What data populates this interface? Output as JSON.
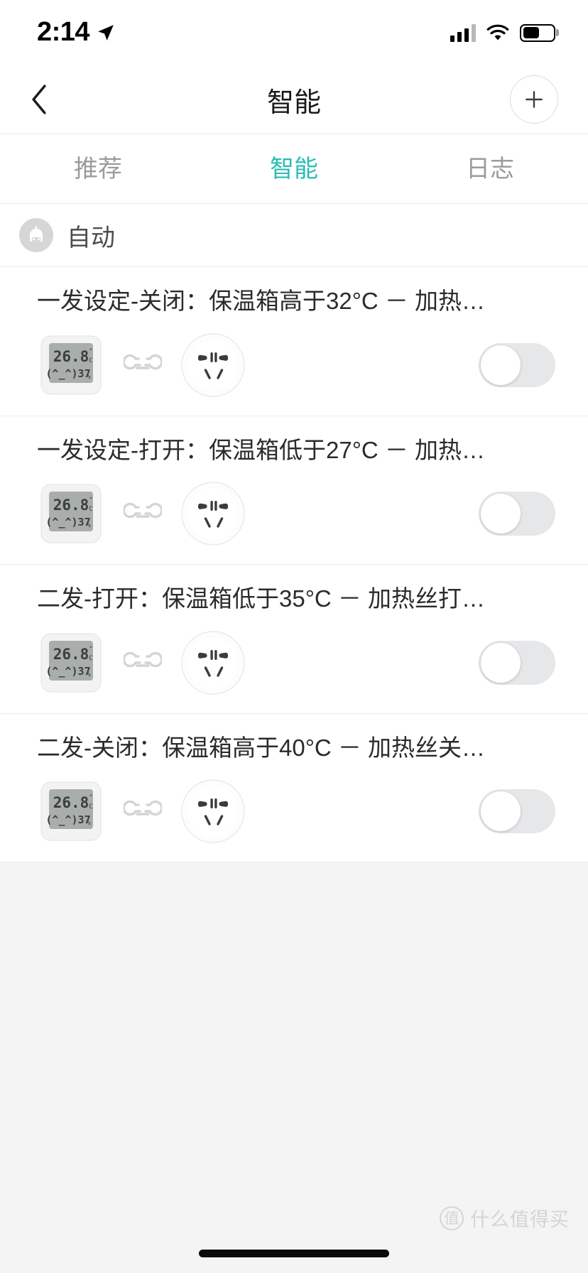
{
  "status_bar": {
    "time": "2:14",
    "location_icon": "location-arrow-icon",
    "signal_icon": "cellular-signal-icon",
    "wifi_icon": "wifi-icon",
    "battery_icon": "battery-icon",
    "battery_level_percent": 55
  },
  "nav": {
    "back_icon": "chevron-left-icon",
    "title": "智能",
    "add_icon": "plus-icon"
  },
  "tabs": [
    {
      "label": "推荐",
      "active": false
    },
    {
      "label": "智能",
      "active": true
    },
    {
      "label": "日志",
      "active": false
    }
  ],
  "section": {
    "icon": "automation-robot-icon",
    "title": "自动"
  },
  "automations": [
    {
      "title": "一发设定-关闭：保温箱高于32°C － 加热…",
      "trigger_device": {
        "icon": "thermometer-hygrometer-icon",
        "temperature": "26.8",
        "temp_unit": "°C",
        "humidity": "37",
        "humidity_unit": "%",
        "face": "(^_^)"
      },
      "link_icon": "link-chain-icon",
      "action_device": {
        "icon": "power-socket-icon"
      },
      "enabled": false
    },
    {
      "title": "一发设定-打开：保温箱低于27°C － 加热…",
      "trigger_device": {
        "icon": "thermometer-hygrometer-icon",
        "temperature": "26.8",
        "temp_unit": "°C",
        "humidity": "37",
        "humidity_unit": "%",
        "face": "(^_^)"
      },
      "link_icon": "link-chain-icon",
      "action_device": {
        "icon": "power-socket-icon"
      },
      "enabled": false
    },
    {
      "title": "二发-打开：保温箱低于35°C － 加热丝打…",
      "trigger_device": {
        "icon": "thermometer-hygrometer-icon",
        "temperature": "26.8",
        "temp_unit": "°C",
        "humidity": "37",
        "humidity_unit": "%",
        "face": "(^_^)"
      },
      "link_icon": "link-chain-icon",
      "action_device": {
        "icon": "power-socket-icon"
      },
      "enabled": false
    },
    {
      "title": "二发-关闭：保温箱高于40°C － 加热丝关…",
      "trigger_device": {
        "icon": "thermometer-hygrometer-icon",
        "temperature": "26.8",
        "temp_unit": "°C",
        "humidity": "37",
        "humidity_unit": "%",
        "face": "(^_^)"
      },
      "link_icon": "link-chain-icon",
      "action_device": {
        "icon": "power-socket-icon"
      },
      "enabled": false
    }
  ],
  "watermark": {
    "badge": "值",
    "text": "什么值得买"
  },
  "colors": {
    "accent": "#2bbcb4",
    "title_text": "#1a1a1a",
    "muted_text": "#9b9b9b",
    "page_bg": "#f4f4f4",
    "card_bg": "#ffffff",
    "toggle_off_track": "#e6e7e9"
  }
}
